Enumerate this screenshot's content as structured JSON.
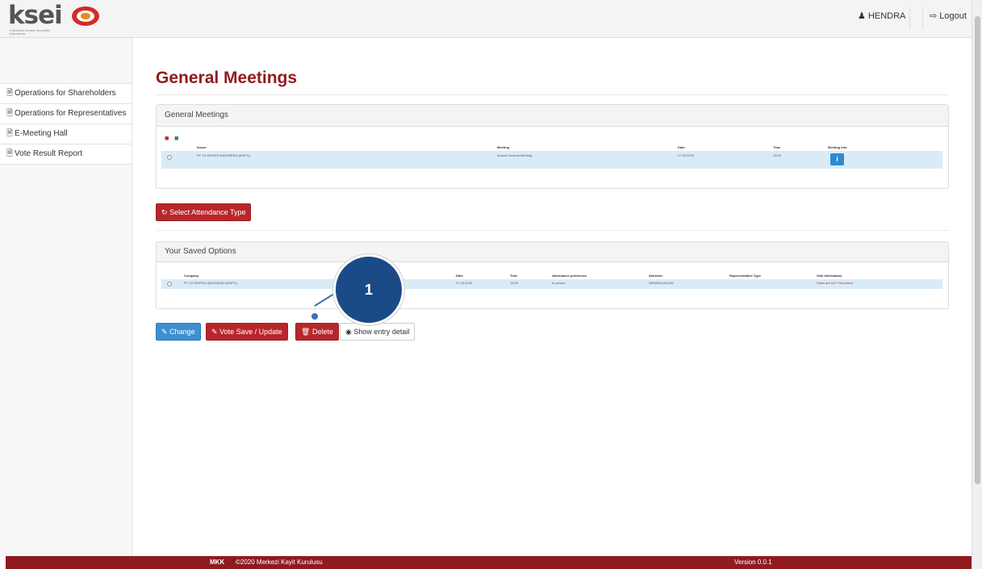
{
  "header": {
    "logo_text": "ksei",
    "logo_subtitle": "Indonesia Central Securities Depository",
    "user_icon": "user-icon",
    "user_name": "HENDRA",
    "logout_icon": "logout-icon",
    "logout_label": "Logout"
  },
  "sidebar": {
    "items": [
      {
        "icon": "document-icon",
        "label": "Operations for Shareholders"
      },
      {
        "icon": "document-icon",
        "label": "Operations for Representatives"
      },
      {
        "icon": "document-icon",
        "label": "E-Meeting Hall"
      },
      {
        "icon": "document-icon",
        "label": "Vote Result Report"
      }
    ]
  },
  "main": {
    "title": "General Meetings",
    "meetings_panel": {
      "title": "General Meetings",
      "columns": [
        "Issuer",
        "Meeting",
        "Date",
        "Time",
        "Meeting Info"
      ],
      "rows": [
        {
          "issuer": "PT XX EMITEN INDONESIA (IEMT1)",
          "meeting": "Annual General Meeting",
          "date": "27.03.2020",
          "time": "15:00",
          "info_icon": "i"
        }
      ]
    },
    "attendance_button": "Select Attendance Type",
    "saved_panel": {
      "title": "Your Saved Options",
      "columns": [
        "Company",
        "Date",
        "Time",
        "Attendance preference",
        "Attendee",
        "Representative Type",
        "Vote Information"
      ],
      "rows": [
        {
          "company": "PT XX EMITEN INDONESIA (IEMT1)",
          "date": "27.03.2020",
          "time": "15:00",
          "attendance": "In person",
          "attendee": "HENDRA ASLAN",
          "rep_type": "-",
          "vote_info": "Votes are NOT Recorded"
        }
      ]
    },
    "buttons": {
      "change": "Change",
      "vote_save": "Vote Save / Update",
      "delete": "Delete",
      "show_detail": "Show entry detail"
    },
    "callout_number": "1"
  },
  "footer": {
    "logo": "MKK",
    "copyright": "©2020 Merkezi Kayit Kurulusu",
    "version": "Version 0.0.1"
  },
  "colors": {
    "brand_red": "#8f1b1f",
    "button_red": "#b8262b",
    "button_blue": "#3d8fcf",
    "row_highlight": "#d9ebf7",
    "callout": "#1b4b86"
  }
}
